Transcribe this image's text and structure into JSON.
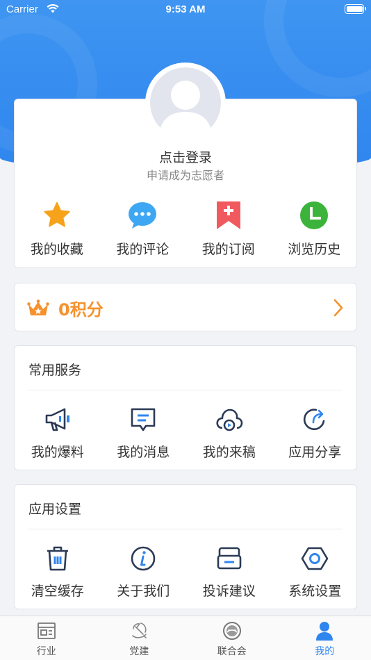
{
  "status_bar": {
    "carrier": "Carrier",
    "time": "9:53 AM",
    "battery_level": 1.0
  },
  "profile": {
    "login_prompt": "点击登录",
    "volunteer_prompt": "申请成为志愿者",
    "quick_actions": [
      {
        "label": "我的收藏",
        "icon": "star-icon",
        "color": "#f7a21b"
      },
      {
        "label": "我的评论",
        "icon": "chat-bubble-icon",
        "color": "#3ea7f3"
      },
      {
        "label": "我的订阅",
        "icon": "bookmark-plus-icon",
        "color": "#f05a5f"
      },
      {
        "label": "浏览历史",
        "icon": "clock-icon",
        "color": "#3cb33a"
      }
    ]
  },
  "points": {
    "label": "0积分",
    "icon": "crown-icon",
    "color": "#f5922e"
  },
  "services": {
    "title": "常用服务",
    "items": [
      {
        "label": "我的爆料",
        "icon": "megaphone-icon"
      },
      {
        "label": "我的消息",
        "icon": "message-icon"
      },
      {
        "label": "我的来稿",
        "icon": "cloud-upload-icon"
      },
      {
        "label": "应用分享",
        "icon": "share-icon"
      }
    ]
  },
  "settings": {
    "title": "应用设置",
    "items": [
      {
        "label": "清空缓存",
        "icon": "trash-icon"
      },
      {
        "label": "关于我们",
        "icon": "info-icon"
      },
      {
        "label": "投诉建议",
        "icon": "complaint-icon"
      },
      {
        "label": "系统设置",
        "icon": "hexagon-settings-icon"
      }
    ]
  },
  "tabbar": {
    "tabs": [
      {
        "label": "行业",
        "icon": "industry-icon",
        "active": false
      },
      {
        "label": "党建",
        "icon": "party-icon",
        "active": false
      },
      {
        "label": "联合会",
        "icon": "federation-icon",
        "active": false
      },
      {
        "label": "我的",
        "icon": "person-icon",
        "active": true
      }
    ],
    "active_color": "#2f86ee"
  },
  "colors": {
    "brand": "#2f86ee",
    "icon_dark": "#2b3a55",
    "accent": "#f5922e"
  }
}
